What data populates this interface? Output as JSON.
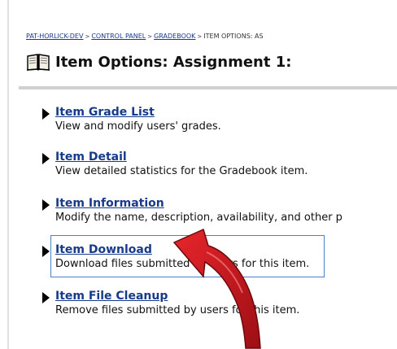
{
  "breadcrumb": {
    "items": [
      "PAT-HORLICK-DEV",
      "CONTROL PANEL",
      "GRADEBOOK"
    ],
    "separator": ">",
    "current": "ITEM OPTIONS: AS"
  },
  "header": {
    "title": "Item Options: Assignment 1:",
    "icon": "book-icon"
  },
  "menu": {
    "items": [
      {
        "label": "Item Grade List",
        "description": "View and modify users' grades."
      },
      {
        "label": "Item Detail",
        "description": "View detailed statistics for the Gradebook item."
      },
      {
        "label": "Item Information",
        "description": "Modify the name, description, availability, and other p"
      },
      {
        "label": "Item Download",
        "description": "Download files submitted by users for this item."
      },
      {
        "label": "Item File Cleanup",
        "description": "Remove files submitted by users for this item."
      }
    ]
  },
  "annotation": {
    "highlighted_item": "Item Download",
    "arrow_color": "#c0151b",
    "box_color": "#4a7fd1"
  },
  "colors": {
    "link": "#173a8a",
    "text": "#111111",
    "divider": "#d0d0d0"
  }
}
